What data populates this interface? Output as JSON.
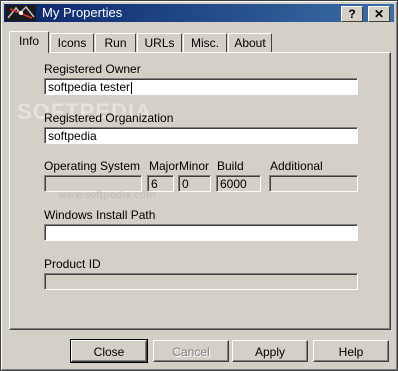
{
  "window": {
    "title": "My Properties",
    "help_label": "?",
    "close_label": "✕"
  },
  "tabs": [
    {
      "label": "Info"
    },
    {
      "label": "Icons"
    },
    {
      "label": "Run"
    },
    {
      "label": "URLs"
    },
    {
      "label": "Misc."
    },
    {
      "label": "About"
    }
  ],
  "info": {
    "owner_label": "Registered Owner",
    "owner_value": "softpedia tester",
    "org_label": "Registered Organization",
    "org_value": "softpedia",
    "os_label": "Operating System",
    "os_value": "",
    "major_label": "Major",
    "major_value": "6",
    "minor_label": "Minor",
    "minor_value": "0",
    "build_label": "Build",
    "build_value": "6000",
    "additional_label": "Additional",
    "additional_value": "",
    "path_label": "Windows Install Path",
    "path_value": "",
    "product_label": "Product ID",
    "product_value": ""
  },
  "watermark": {
    "text": "www.softpedia.com",
    "big_text": "SOFTPEDIA"
  },
  "buttons": {
    "close": "Close",
    "cancel": "Cancel",
    "apply": "Apply",
    "help": "Help"
  }
}
